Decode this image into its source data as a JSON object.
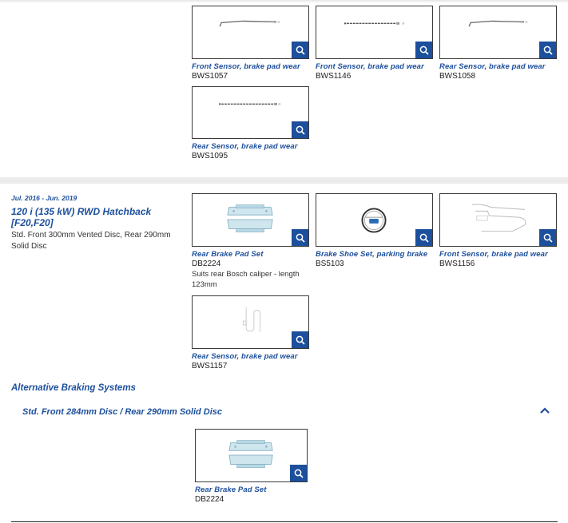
{
  "colors": {
    "brand_blue": "#1c4f9c",
    "band_gray": "#ebebeb"
  },
  "section1": {
    "cards": [
      {
        "title": "Front Sensor, brake pad wear",
        "code": "BWS1057",
        "image": "sensor-wire-image"
      },
      {
        "title": "Front Sensor, brake pad wear",
        "code": "BWS1146",
        "image": "sensor-wire-image"
      },
      {
        "title": "Rear Sensor, brake pad wear",
        "code": "BWS1058",
        "image": "sensor-wire-image"
      },
      {
        "title": "Rear Sensor, brake pad wear",
        "code": "BWS1095",
        "image": "sensor-wire-image"
      }
    ]
  },
  "vehicle": {
    "dates": "Jul. 2016 - Jun. 2019",
    "title": "120 i (135 kW) RWD Hatchback [F20,F20]",
    "description": "Std. Front 300mm Vented Disc, Rear 290mm Solid Disc",
    "cards": [
      {
        "title": "Rear Brake Pad Set",
        "code": "DB2224",
        "note": "Suits rear Bosch caliper - length 123mm",
        "image": "brake-pad-image"
      },
      {
        "title": "Brake Shoe Set, parking brake",
        "code": "BS5103",
        "image": "brake-shoe-image"
      },
      {
        "title": "Front Sensor, brake pad wear",
        "code": "BWS1156",
        "image": "sensor-wire-image"
      },
      {
        "title": "Rear Sensor, brake pad wear",
        "code": "BWS1157",
        "image": "sensor-coil-image"
      }
    ]
  },
  "alternative": {
    "heading": "Alternative Braking Systems",
    "subheading": "Std. Front 284mm Disc / Rear 290mm Solid Disc",
    "toggle_icon": "chevron-up-icon",
    "cards": [
      {
        "title": "Rear Brake Pad Set",
        "code": "DB2224",
        "image": "brake-pad-image"
      }
    ]
  },
  "zoom_icon": "magnifier-icon"
}
